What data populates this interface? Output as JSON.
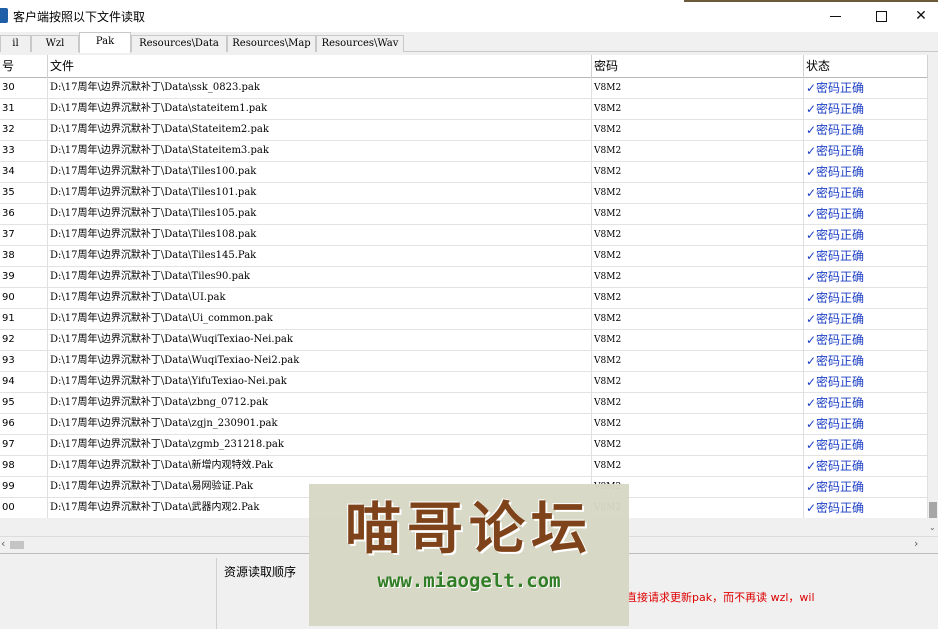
{
  "window": {
    "title": "客户端按照以下文件读取",
    "minimize_icon": "minimize-icon",
    "maximize_icon": "maximize-icon",
    "close_icon": "close-icon",
    "close_glyph": "✕"
  },
  "tabs": [
    {
      "label": "il",
      "active": false
    },
    {
      "label": "Wzl",
      "active": false
    },
    {
      "label": "Pak",
      "active": true
    },
    {
      "label": "Resources\\Data",
      "active": false
    },
    {
      "label": "Resources\\Map",
      "active": false
    },
    {
      "label": "Resources\\Wav",
      "active": false
    }
  ],
  "table": {
    "headers": {
      "num": "号",
      "file": "文件",
      "password": "密码",
      "status": "状态"
    },
    "rows": [
      {
        "num": "30",
        "file": "D:\\17周年\\边界沉默补丁\\Data\\ssk_0823.pak",
        "password": "V8M2",
        "status": "✓密码正确"
      },
      {
        "num": "31",
        "file": "D:\\17周年\\边界沉默补丁\\Data\\stateitem1.pak",
        "password": "V8M2",
        "status": "✓密码正确"
      },
      {
        "num": "32",
        "file": "D:\\17周年\\边界沉默补丁\\Data\\Stateitem2.pak",
        "password": "V8M2",
        "status": "✓密码正确"
      },
      {
        "num": "33",
        "file": "D:\\17周年\\边界沉默补丁\\Data\\Stateitem3.pak",
        "password": "V8M2",
        "status": "✓密码正确"
      },
      {
        "num": "34",
        "file": "D:\\17周年\\边界沉默补丁\\Data\\Tiles100.pak",
        "password": "V8M2",
        "status": "✓密码正确"
      },
      {
        "num": "35",
        "file": "D:\\17周年\\边界沉默补丁\\Data\\Tiles101.pak",
        "password": "V8M2",
        "status": "✓密码正确"
      },
      {
        "num": "36",
        "file": "D:\\17周年\\边界沉默补丁\\Data\\Tiles105.pak",
        "password": "V8M2",
        "status": "✓密码正确"
      },
      {
        "num": "37",
        "file": "D:\\17周年\\边界沉默补丁\\Data\\Tiles108.pak",
        "password": "V8M2",
        "status": "✓密码正确"
      },
      {
        "num": "38",
        "file": "D:\\17周年\\边界沉默补丁\\Data\\Tiles145.Pak",
        "password": "V8M2",
        "status": "✓密码正确"
      },
      {
        "num": "39",
        "file": "D:\\17周年\\边界沉默补丁\\Data\\Tiles90.pak",
        "password": "V8M2",
        "status": "✓密码正确"
      },
      {
        "num": "90",
        "file": "D:\\17周年\\边界沉默补丁\\Data\\UI.pak",
        "password": "V8M2",
        "status": "✓密码正确"
      },
      {
        "num": "91",
        "file": "D:\\17周年\\边界沉默补丁\\Data\\Ui_common.pak",
        "password": "V8M2",
        "status": "✓密码正确"
      },
      {
        "num": "92",
        "file": "D:\\17周年\\边界沉默补丁\\Data\\WuqiTexiao-Nei.pak",
        "password": "V8M2",
        "status": "✓密码正确"
      },
      {
        "num": "93",
        "file": "D:\\17周年\\边界沉默补丁\\Data\\WuqiTexiao-Nei2.pak",
        "password": "V8M2",
        "status": "✓密码正确"
      },
      {
        "num": "94",
        "file": "D:\\17周年\\边界沉默补丁\\Data\\YifuTexiao-Nei.pak",
        "password": "V8M2",
        "status": "✓密码正确"
      },
      {
        "num": "95",
        "file": "D:\\17周年\\边界沉默补丁\\Data\\zbng_0712.pak",
        "password": "V8M2",
        "status": "✓密码正确"
      },
      {
        "num": "96",
        "file": "D:\\17周年\\边界沉默补丁\\Data\\zgjn_230901.pak",
        "password": "V8M2",
        "status": "✓密码正确"
      },
      {
        "num": "97",
        "file": "D:\\17周年\\边界沉默补丁\\Data\\zgmb_231218.pak",
        "password": "V8M2",
        "status": "✓密码正确"
      },
      {
        "num": "98",
        "file": "D:\\17周年\\边界沉默补丁\\Data\\新增内观特效.Pak",
        "password": "V8M2",
        "status": "✓密码正确"
      },
      {
        "num": "99",
        "file": "D:\\17周年\\边界沉默补丁\\Data\\易网验证.Pak",
        "password": "V8M2",
        "status": "✓密码正确"
      },
      {
        "num": "00",
        "file": "D:\\17周年\\边界沉默补丁\\Data\\武器内观2.Pak",
        "password": "V8M2",
        "status": "✓密码正确"
      }
    ]
  },
  "scrollbars": {
    "up_down_arrow": "⌄",
    "left_arrow": "‹",
    "right_arrow": "›"
  },
  "bottom_panel": {
    "group_label": "资源读取顺序",
    "note": "直接请求更新pak，而不再读 wzl，wil"
  },
  "watermark": {
    "title": "喵哥论坛",
    "url": "www.miaogelt.com"
  }
}
